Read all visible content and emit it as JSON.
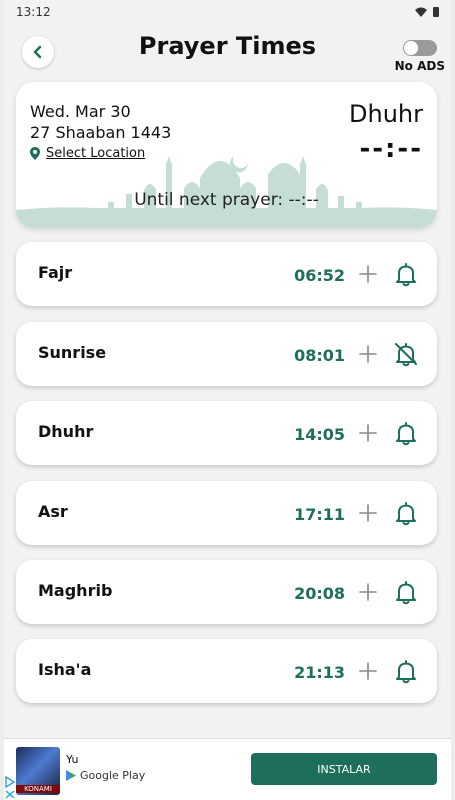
{
  "status_bar": {
    "time": "13:12"
  },
  "header": {
    "title": "Prayer Times",
    "ads_label": "No ADS",
    "ads_enabled": false
  },
  "summary": {
    "gregorian_date": "Wed. Mar 30",
    "hijri_date": "27 Shaaban 1443",
    "location_label": "Select Location",
    "next_prayer_name": "Dhuhr",
    "next_prayer_countdown": "--:--",
    "until_next_label": "Until next prayer: --:--"
  },
  "prayers": [
    {
      "name": "Fajr",
      "time": "06:52",
      "alarm": "on"
    },
    {
      "name": "Sunrise",
      "time": "08:01",
      "alarm": "off"
    },
    {
      "name": "Dhuhr",
      "time": "14:05",
      "alarm": "on"
    },
    {
      "name": "Asr",
      "time": "17:11",
      "alarm": "on"
    },
    {
      "name": "Maghrib",
      "time": "20:08",
      "alarm": "on"
    },
    {
      "name": "Isha'a",
      "time": "21:13",
      "alarm": "on"
    }
  ],
  "ad": {
    "app_name": "Yu",
    "store": "Google Play",
    "thumb_label": "KONAMI",
    "cta": "INSTALAR"
  },
  "colors": {
    "accent": "#1e6e5c",
    "mosque": "#c5ddd6"
  }
}
